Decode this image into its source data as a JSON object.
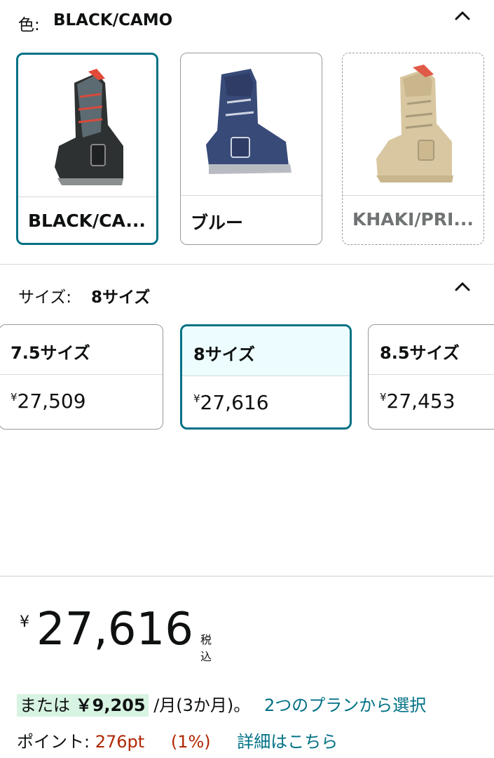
{
  "color_section": {
    "label": "色:",
    "value": "BLACK/CAMO",
    "options": [
      {
        "name": "BLACK/CA...",
        "state": "selected"
      },
      {
        "name": "ブルー",
        "state": "available"
      },
      {
        "name": "KHAKI/PRI...",
        "state": "unavailable"
      }
    ]
  },
  "size_section": {
    "label": "サイズ:",
    "value": "8サイズ",
    "options": [
      {
        "name": "7.5サイズ",
        "currency": "¥",
        "price": "27,509",
        "state": "available"
      },
      {
        "name": "8サイズ",
        "currency": "¥",
        "price": "27,616",
        "state": "selected"
      },
      {
        "name": "8.5サイズ",
        "currency": "¥",
        "price": "27,453",
        "state": "available"
      }
    ]
  },
  "price": {
    "currency": "¥",
    "amount": "27,616",
    "tax_label": "税込"
  },
  "installment": {
    "prefix": "または",
    "amount": "￥9,205",
    "period": "/月(3か月)。",
    "link": "2つのプランから選択"
  },
  "points": {
    "label": "ポイント:",
    "value": "276pt",
    "percent": "(1%)",
    "link": "詳細はこちら"
  },
  "colors": {
    "accent": "#007185",
    "selected_bg": "#edfdff",
    "points": "#b12704",
    "highlight": "#d7f3e2"
  }
}
